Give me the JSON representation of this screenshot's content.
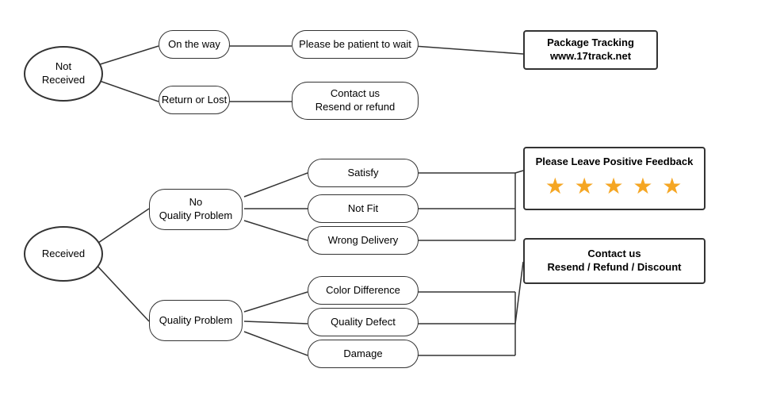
{
  "nodes": {
    "not_received": {
      "label": "Not\nReceived"
    },
    "on_the_way": {
      "label": "On the way"
    },
    "patient": {
      "label": "Please be patient to wait"
    },
    "package_tracking": {
      "label": "Package Tracking\nwww.17track.net"
    },
    "return_lost": {
      "label": "Return or Lost"
    },
    "contact_resend_refund": {
      "label": "Contact us\nResend or refund"
    },
    "received": {
      "label": "Received"
    },
    "no_quality_problem": {
      "label": "No\nQuality Problem"
    },
    "satisfy": {
      "label": "Satisfy"
    },
    "not_fit": {
      "label": "Not Fit"
    },
    "wrong_delivery": {
      "label": "Wrong Delivery"
    },
    "quality_problem": {
      "label": "Quality Problem"
    },
    "color_difference": {
      "label": "Color Difference"
    },
    "quality_defect": {
      "label": "Quality Defect"
    },
    "damage": {
      "label": "Damage"
    },
    "please_positive": {
      "label": "Please Leave Positive Feedback"
    },
    "stars": {
      "label": "★ ★ ★ ★ ★"
    },
    "contact_resend_refund_discount": {
      "label": "Contact us\nResend / Refund / Discount"
    }
  }
}
